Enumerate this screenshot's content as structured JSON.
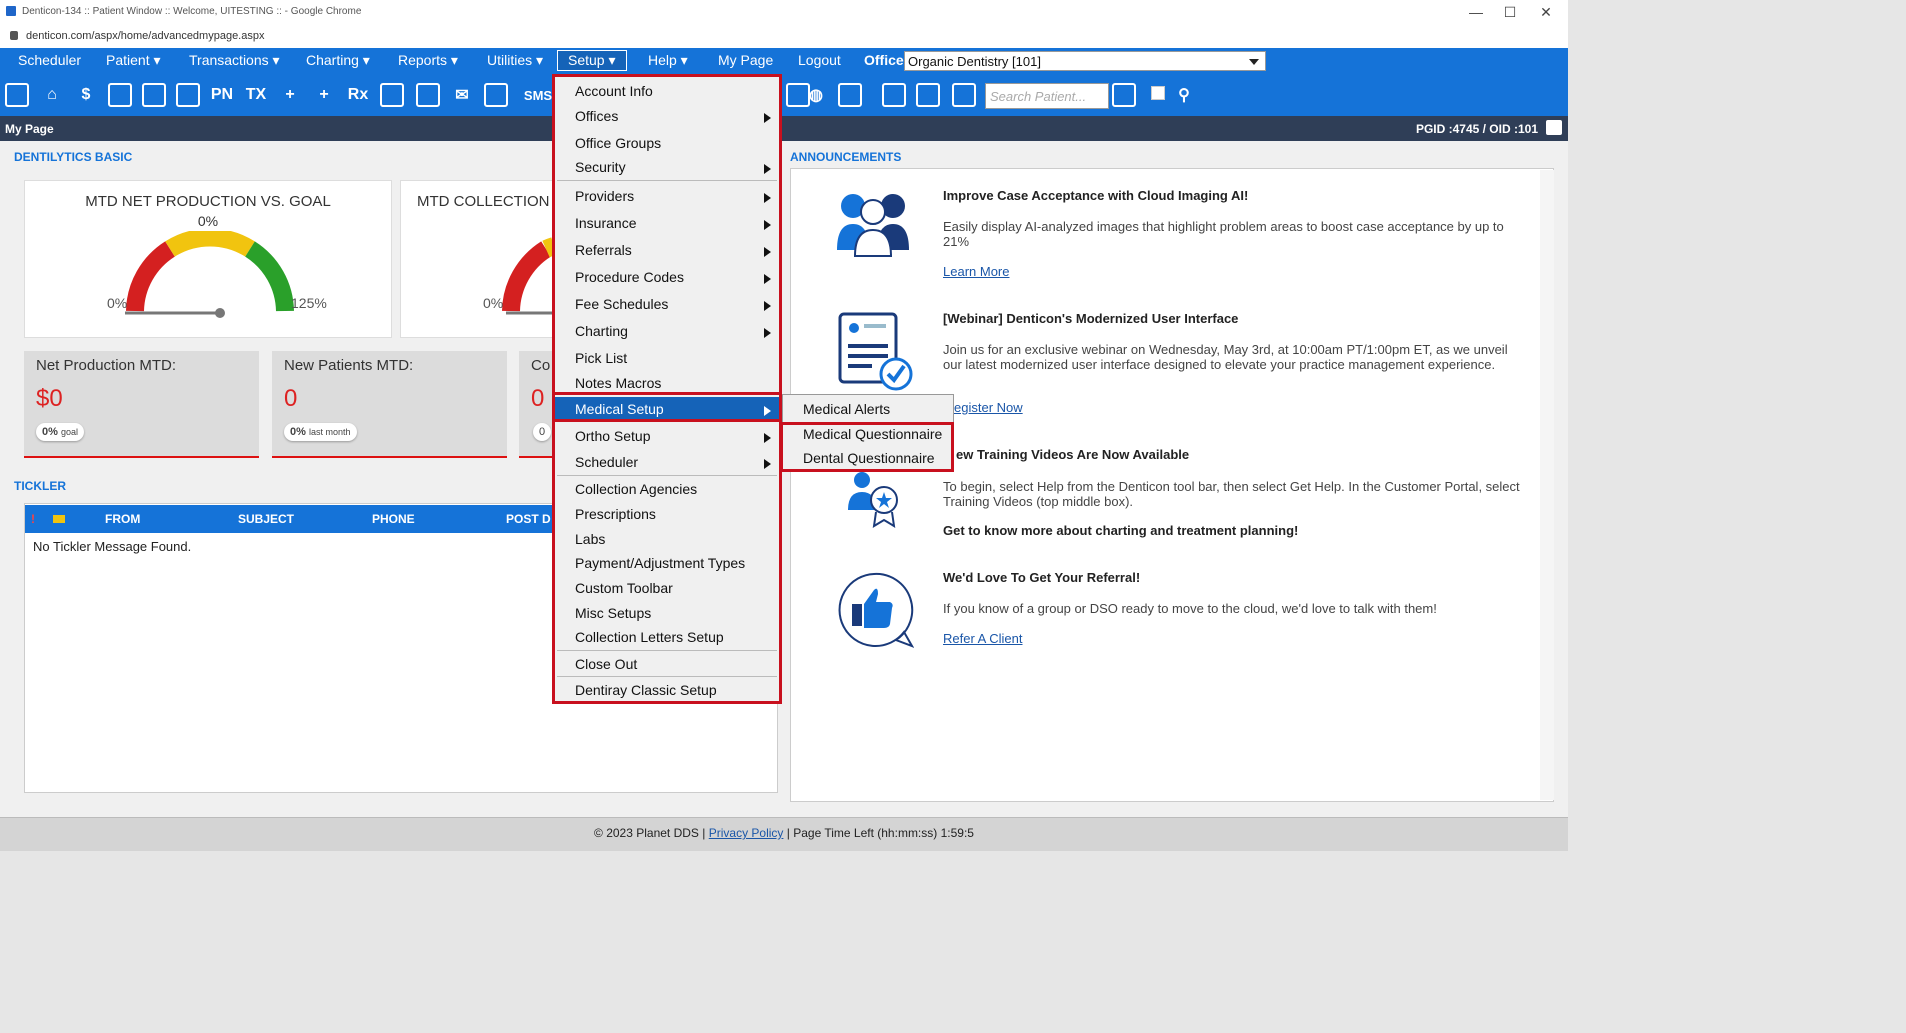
{
  "window": {
    "title": "Denticon-134 :: Patient Window :: Welcome, UITESTING :: - Google Chrome",
    "url": "denticon.com/aspx/home/advancedmypage.aspx"
  },
  "nav": {
    "items": [
      {
        "label": "Scheduler"
      },
      {
        "label": "Patient ▾"
      },
      {
        "label": "Transactions ▾"
      },
      {
        "label": "Charting ▾"
      },
      {
        "label": "Reports ▾"
      },
      {
        "label": "Utilities ▾"
      },
      {
        "label": "Setup ▾"
      },
      {
        "label": "Help ▾"
      },
      {
        "label": "My Page"
      },
      {
        "label": "Logout"
      }
    ],
    "office_label": "Office",
    "office_value": "Organic Dentistry [101]"
  },
  "toolbar": {
    "search_placeholder": "Search Patient...",
    "icons": [
      "PN",
      "TX",
      "Rx",
      "SMS"
    ]
  },
  "page": {
    "title": "My Page",
    "pgid": "PGID :4745  /  OID :101"
  },
  "dentilytics": {
    "section_title": "DENTILYTICS BASIC",
    "gauge1": {
      "title": "MTD NET PRODUCTION VS. GOAL",
      "pct": "0%",
      "min": "0%",
      "max": "125%"
    },
    "gauge2": {
      "title": "MTD COLLECTION",
      "min": "0%"
    },
    "stats": [
      {
        "label": "Net Production MTD:",
        "value": "$0",
        "pill": "0%",
        "pill_sub": "goal"
      },
      {
        "label": "New Patients MTD:",
        "value": "0",
        "pill": "0%",
        "pill_sub": "last month"
      },
      {
        "label": "Co",
        "value": "0",
        "pill": "0"
      }
    ]
  },
  "tickler": {
    "section_title": "TICKLER",
    "columns": [
      "!",
      "FROM",
      "SUBJECT",
      "PHONE",
      "POST D"
    ],
    "empty_message": "No Tickler Message Found."
  },
  "announcements": {
    "section_title": "ANNOUNCEMENTS",
    "items": [
      {
        "title": "Improve Case Acceptance with Cloud Imaging AI!",
        "text": "Easily display AI-analyzed images that highlight problem areas to boost case acceptance by up to 21%",
        "link": "Learn More"
      },
      {
        "title": "[Webinar] Denticon's Modernized User Interface",
        "text": "Join us for an exclusive webinar on Wednesday, May 3rd, at 10:00am PT/1:00pm ET, as we unveil our latest modernized user interface designed to elevate your practice management experience.",
        "link": "egister Now"
      },
      {
        "title": "ew Training Videos Are Now Available",
        "text": "To begin, select Help from the Denticon tool bar, then select Get Help. In the Customer Portal, select Training Videos (top middle box).",
        "extra": "Get to know more about charting and treatment planning!"
      },
      {
        "title": "We'd Love To Get Your Referral!",
        "text": "If you know of a group or DSO ready to move to the cloud, we'd love to talk with them!",
        "link": "Refer A Client"
      }
    ]
  },
  "setup_menu": {
    "items": [
      {
        "label": "Account Info"
      },
      {
        "label": "Offices"
      },
      {
        "label": "Office Groups"
      },
      {
        "label": "Security"
      },
      {
        "label": "Providers"
      },
      {
        "label": "Insurance"
      },
      {
        "label": "Referrals"
      },
      {
        "label": "Procedure Codes"
      },
      {
        "label": "Fee Schedules"
      },
      {
        "label": "Charting"
      },
      {
        "label": "Pick List"
      },
      {
        "label": "Notes Macros"
      },
      {
        "label": "Medical Setup"
      },
      {
        "label": "Ortho Setup"
      },
      {
        "label": "Scheduler"
      },
      {
        "label": "Collection Agencies"
      },
      {
        "label": "Prescriptions"
      },
      {
        "label": "Labs"
      },
      {
        "label": "Payment/Adjustment Types"
      },
      {
        "label": "Custom Toolbar"
      },
      {
        "label": "Misc Setups"
      },
      {
        "label": "Collection Letters Setup"
      },
      {
        "label": "Close Out"
      },
      {
        "label": "Dentiray Classic Setup"
      }
    ]
  },
  "medical_submenu": {
    "items": [
      {
        "label": "Medical Alerts"
      },
      {
        "label": "Medical Questionnaire"
      },
      {
        "label": "Dental Questionnaire"
      }
    ]
  },
  "footer": {
    "copyright": "© 2023 Planet DDS |",
    "privacy": "Privacy Policy",
    "time_left": "| Page Time Left (hh:mm:ss) 1:59:5"
  }
}
